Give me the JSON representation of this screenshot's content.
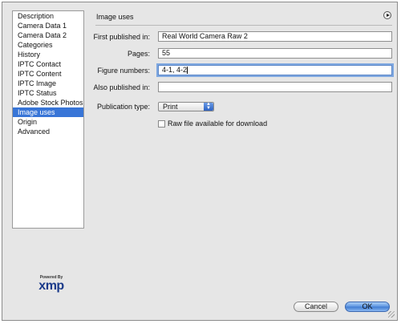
{
  "sidebar": {
    "items": [
      {
        "label": "Description",
        "selected": false
      },
      {
        "label": "Camera Data 1",
        "selected": false
      },
      {
        "label": "Camera Data 2",
        "selected": false
      },
      {
        "label": "Categories",
        "selected": false
      },
      {
        "label": "History",
        "selected": false
      },
      {
        "label": "IPTC Contact",
        "selected": false
      },
      {
        "label": "IPTC Content",
        "selected": false
      },
      {
        "label": "IPTC Image",
        "selected": false
      },
      {
        "label": "IPTC Status",
        "selected": false
      },
      {
        "label": "Adobe Stock Photos",
        "selected": false
      },
      {
        "label": "Image uses",
        "selected": true
      },
      {
        "label": "Origin",
        "selected": false
      },
      {
        "label": "Advanced",
        "selected": false
      }
    ]
  },
  "branding": {
    "powered_by": "Powered By",
    "logo_text": "xmp"
  },
  "panel": {
    "title": "Image uses",
    "flyout_icon": "circle-play-icon",
    "fields": {
      "first_published": {
        "label": "First published in:",
        "value": "Real World Camera Raw 2"
      },
      "pages": {
        "label": "Pages:",
        "value": "55"
      },
      "figure_numbers": {
        "label": "Figure numbers:",
        "value": "4-1, 4-2"
      },
      "also_published": {
        "label": "Also published in:",
        "value": ""
      }
    },
    "publication_type": {
      "label": "Publication type:",
      "selected": "Print"
    },
    "raw_available": {
      "label": "Raw file available for download",
      "checked": false
    }
  },
  "buttons": {
    "cancel": "Cancel",
    "ok": "OK"
  },
  "colors": {
    "selection": "#3875d7",
    "ok_button": "#5b94e0",
    "logo": "#1a3a8a"
  }
}
